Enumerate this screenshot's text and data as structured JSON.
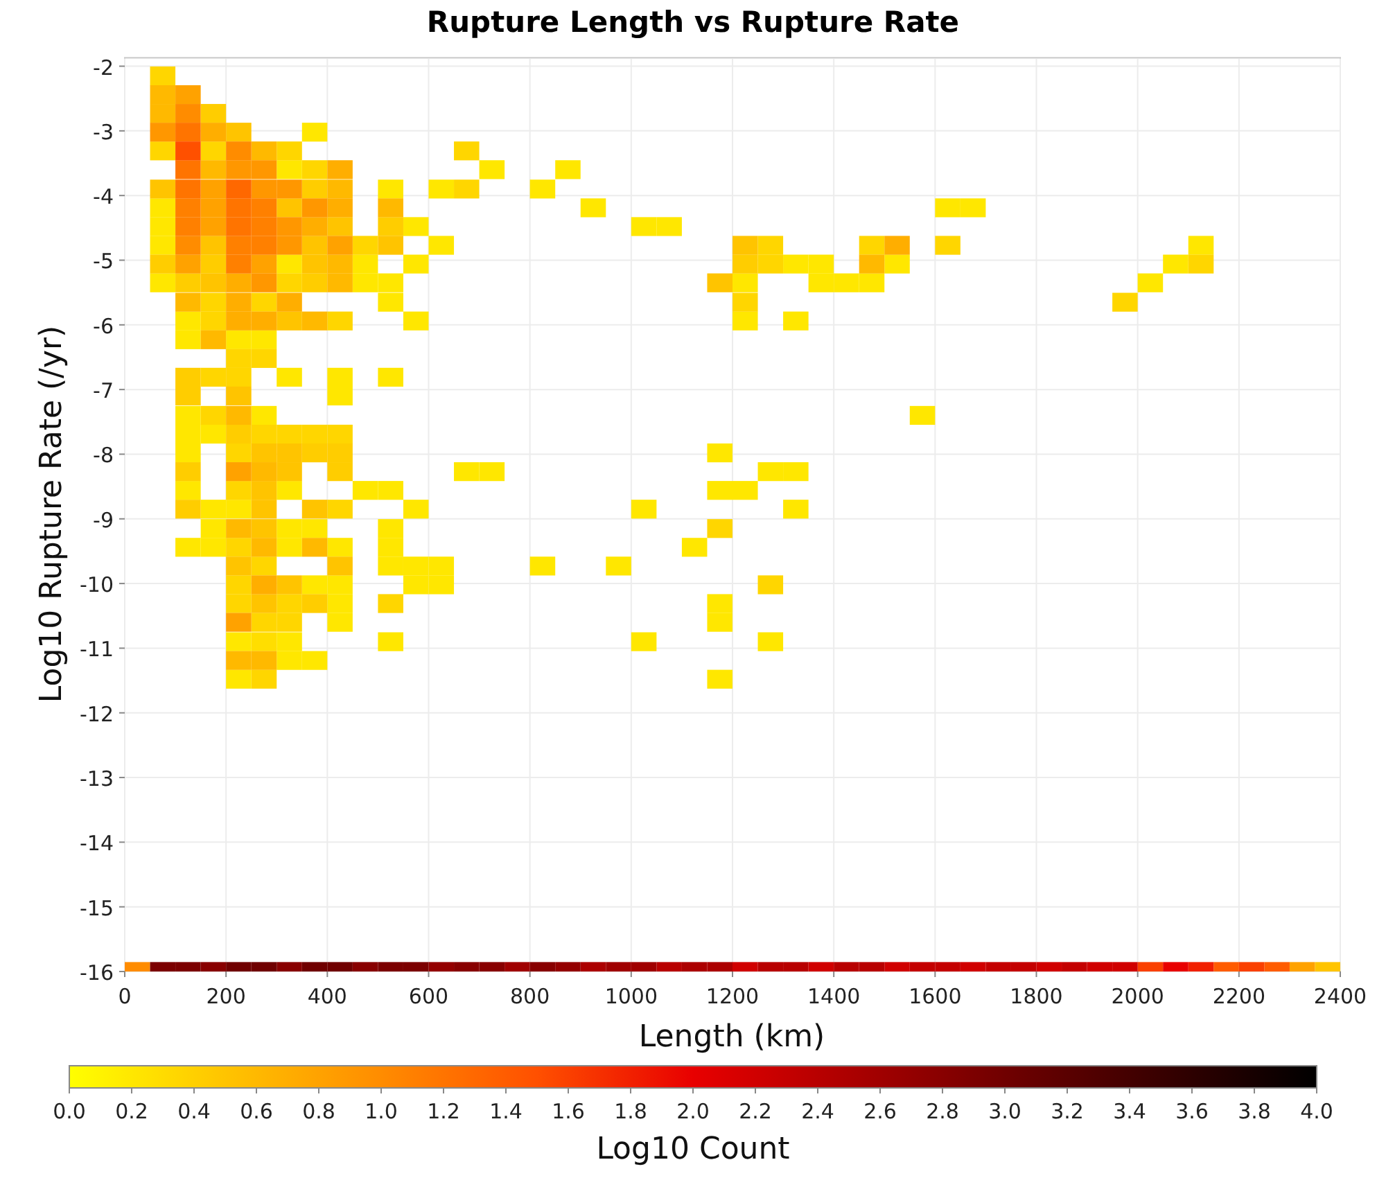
{
  "chart_data": {
    "type": "heatmap",
    "grid": true,
    "title": "Rupture Length vs Rupture Rate",
    "xlabel": "Length (km)",
    "ylabel": "Log10 Rupture Rate (/yr)",
    "xlim": [
      0,
      2400
    ],
    "ylim": [
      -16,
      -1.87
    ],
    "xticks": [
      0,
      200,
      400,
      600,
      800,
      1000,
      1200,
      1400,
      1600,
      1800,
      2000,
      2200,
      2400
    ],
    "yticks": [
      -2,
      -3,
      -4,
      -5,
      -6,
      -7,
      -8,
      -9,
      -10,
      -11,
      -12,
      -13,
      -14,
      -15,
      -16
    ]
  },
  "color_scale": {
    "title": "Log10 Count",
    "ticks": [
      "0.0",
      "0.2",
      "0.4",
      "0.6",
      "0.8",
      "1.0",
      "1.2",
      "1.4",
      "1.6",
      "1.8",
      "2.0",
      "2.2",
      "2.4",
      "2.6",
      "2.8",
      "3.0",
      "3.2",
      "3.4",
      "3.6",
      "3.8",
      "4.0"
    ]
  }
}
